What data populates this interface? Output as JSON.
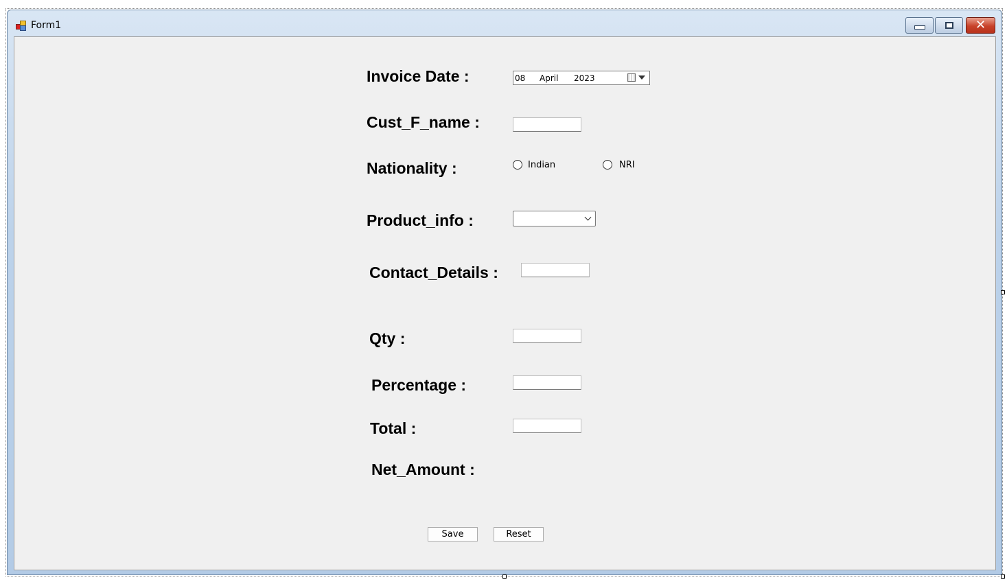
{
  "window": {
    "title": "Form1"
  },
  "form": {
    "invoice_date": {
      "label": "Invoice Date :",
      "day": "08",
      "month": "April",
      "year": "2023"
    },
    "cust_f_name": {
      "label": "Cust_F_name :",
      "value": ""
    },
    "nationality": {
      "label": "Nationality :",
      "options": [
        "Indian",
        "NRI"
      ],
      "selected": null
    },
    "product_info": {
      "label": "Product_info :",
      "value": ""
    },
    "contact_details": {
      "label": "Contact_Details :",
      "value": ""
    },
    "qty": {
      "label": "Qty :",
      "value": ""
    },
    "percentage": {
      "label": "Percentage :",
      "value": ""
    },
    "total": {
      "label": "Total :",
      "value": ""
    },
    "net_amount": {
      "label": "Net_Amount :"
    }
  },
  "buttons": {
    "save": "Save",
    "reset": "Reset"
  },
  "icons": {
    "app": "app-form-icon",
    "minimize": "minimize-icon",
    "maximize": "maximize-icon",
    "close": "close-icon",
    "calendar": "calendar-icon",
    "dropdown": "chevron-down-icon"
  },
  "colors": {
    "client_bg": "#f0f0f0",
    "title_bg": "#bcd2ea",
    "close_btn": "#c8422a"
  }
}
